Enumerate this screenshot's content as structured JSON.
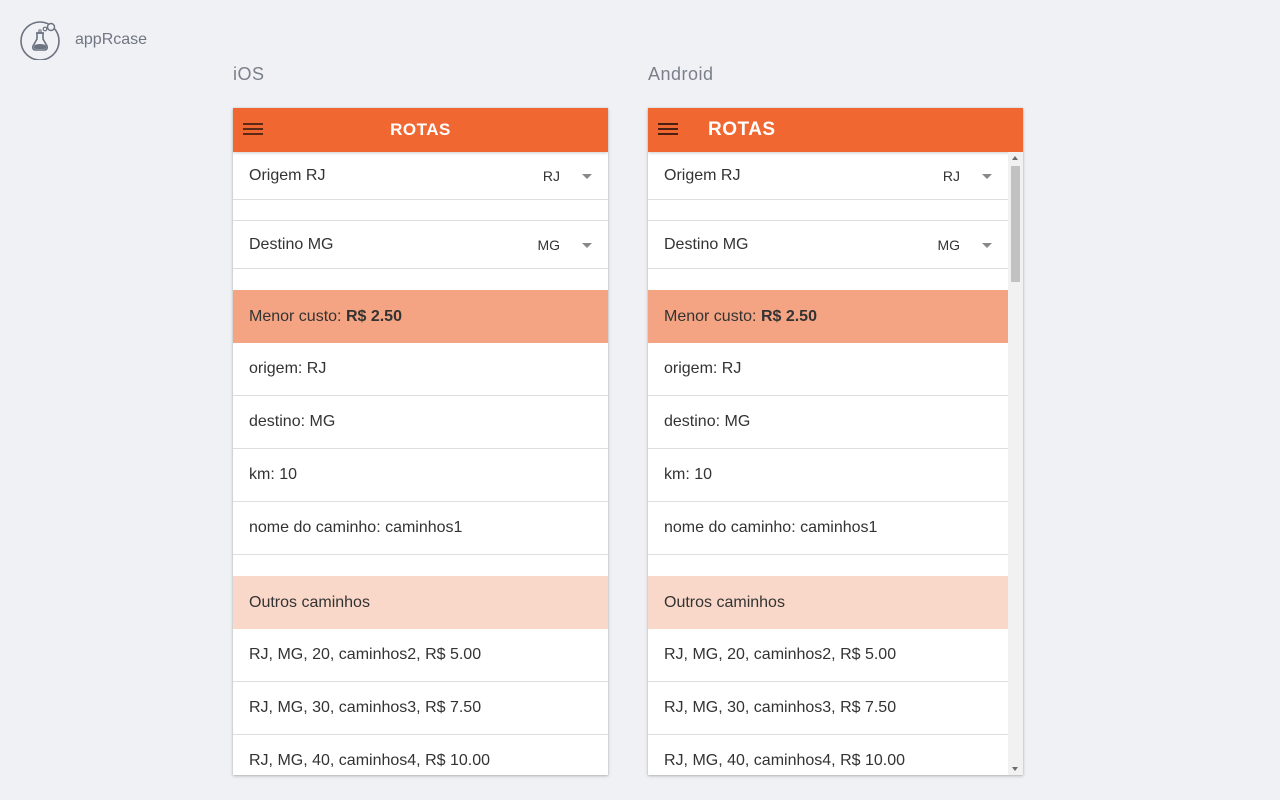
{
  "brand": {
    "name": "appRcase",
    "logo_icon": "flask-icon"
  },
  "panels": [
    {
      "platform": "iOS",
      "title": "ROTAS",
      "origin": {
        "label": "Origem RJ",
        "value": "RJ"
      },
      "destination": {
        "label": "Destino MG",
        "value": "MG"
      },
      "best": {
        "header_prefix": "Menor custo: ",
        "header_value": "R$ 2.50",
        "rows": [
          "origem: RJ",
          "destino: MG",
          "km: 10",
          "nome do caminho: caminhos1"
        ]
      },
      "others": {
        "header": "Outros caminhos",
        "rows": [
          "RJ, MG, 20, caminhos2, R$ 5.00",
          "RJ, MG, 30, caminhos3, R$ 7.50",
          "RJ, MG, 40, caminhos4, R$ 10.00"
        ]
      }
    },
    {
      "platform": "Android",
      "title": "ROTAS",
      "origin": {
        "label": "Origem RJ",
        "value": "RJ"
      },
      "destination": {
        "label": "Destino MG",
        "value": "MG"
      },
      "best": {
        "header_prefix": "Menor custo: ",
        "header_value": "R$ 2.50",
        "rows": [
          "origem: RJ",
          "destino: MG",
          "km: 10",
          "nome do caminho: caminhos1"
        ]
      },
      "others": {
        "header": "Outros caminhos",
        "rows": [
          "RJ, MG, 20, caminhos2, R$ 5.00",
          "RJ, MG, 30, caminhos3, R$ 7.50",
          "RJ, MG, 40, caminhos4, R$ 10.00"
        ]
      }
    }
  ],
  "colors": {
    "toolbar": "#f06732",
    "best_header": "#f4a482",
    "others_header": "#fad8c9",
    "background": "#f0f1f4"
  }
}
